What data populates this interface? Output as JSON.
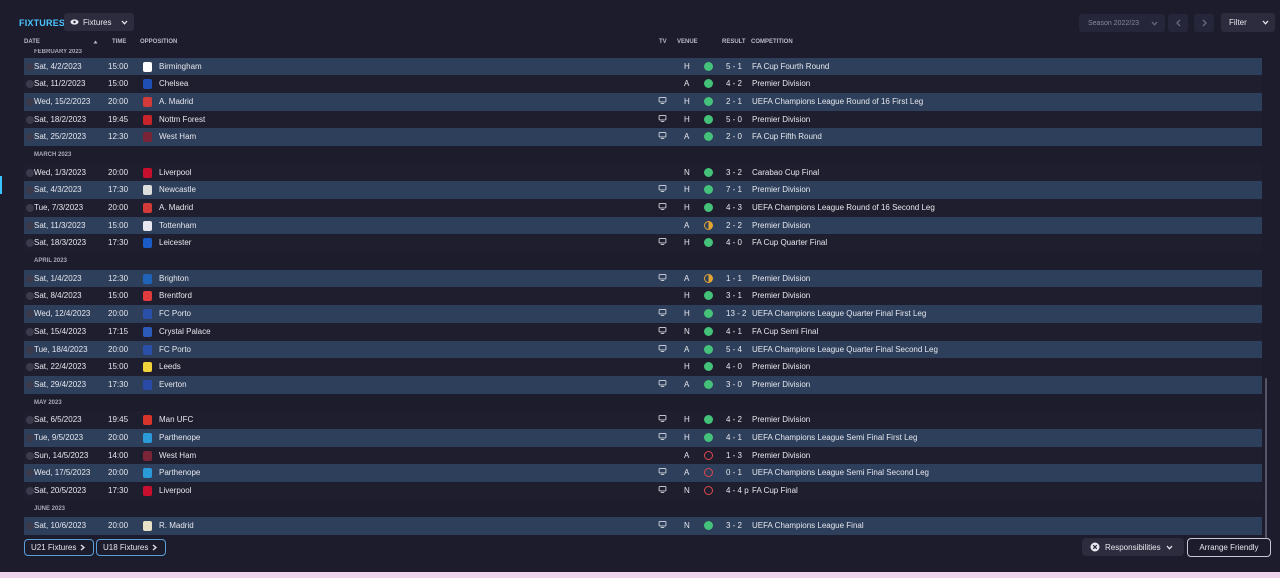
{
  "title": "FIXTURES",
  "view_selector": {
    "label": "Fixtures",
    "icon": "eye-icon"
  },
  "season": {
    "label": "Season 2022/23"
  },
  "filter_label": "Filter",
  "columns": {
    "date": "DATE",
    "time": "TIME",
    "opposition": "OPPOSITION",
    "tv": "TV",
    "venue": "VENUE",
    "result": "RESULT",
    "competition": "COMPETITION"
  },
  "sort": {
    "column": "date",
    "direction": "ascending"
  },
  "colors": {
    "win": "#45c27a",
    "draw": "#e4a535",
    "loss": "#e0474c",
    "accent": "#4cc5ff"
  },
  "sections": [
    {
      "month": "FEBRUARY 2023",
      "fixtures": [
        {
          "date": "Sat, 4/2/2023",
          "time": "15:00",
          "opp": "Birmingham",
          "crest": "#ffffff",
          "tv": false,
          "venue": "H",
          "outcome": "win",
          "result": "5 - 1",
          "comp": "FA Cup Fourth Round"
        },
        {
          "date": "Sat, 11/2/2023",
          "time": "15:00",
          "opp": "Chelsea",
          "crest": "#1f4fb4",
          "tv": false,
          "venue": "A",
          "outcome": "win",
          "result": "4 - 2",
          "comp": "Premier Division"
        },
        {
          "date": "Wed, 15/2/2023",
          "time": "20:00",
          "opp": "A. Madrid",
          "crest": "#d33a3a",
          "tv": true,
          "venue": "H",
          "outcome": "win",
          "result": "2 - 1",
          "comp": "UEFA Champions League Round of 16  First Leg"
        },
        {
          "date": "Sat, 18/2/2023",
          "time": "19:45",
          "opp": "Nottm Forest",
          "crest": "#c8242c",
          "tv": true,
          "venue": "H",
          "outcome": "win",
          "result": "5 - 0",
          "comp": "Premier Division"
        },
        {
          "date": "Sat, 25/2/2023",
          "time": "12:30",
          "opp": "West Ham",
          "crest": "#7a2438",
          "tv": true,
          "venue": "A",
          "outcome": "win",
          "result": "2 - 0",
          "comp": "FA Cup Fifth Round"
        }
      ]
    },
    {
      "month": "MARCH 2023",
      "fixtures": [
        {
          "date": "Wed, 1/3/2023",
          "time": "20:00",
          "opp": "Liverpool",
          "crest": "#c8102e",
          "tv": false,
          "venue": "N",
          "outcome": "win",
          "result": "3 - 2",
          "comp": "Carabao Cup Final"
        },
        {
          "date": "Sat, 4/3/2023",
          "time": "17:30",
          "opp": "Newcastle",
          "crest": "#dddddd",
          "tv": true,
          "venue": "H",
          "outcome": "win",
          "result": "7 - 1",
          "comp": "Premier Division"
        },
        {
          "date": "Tue, 7/3/2023",
          "time": "20:00",
          "opp": "A. Madrid",
          "crest": "#d33a3a",
          "tv": true,
          "venue": "H",
          "outcome": "win",
          "result": "4 - 3",
          "comp": "UEFA Champions League Round of 16  Second Leg"
        },
        {
          "date": "Sat, 11/3/2023",
          "time": "15:00",
          "opp": "Tottenham",
          "crest": "#e8e8f0",
          "tv": false,
          "venue": "A",
          "outcome": "draw",
          "result": "2 - 2",
          "comp": "Premier Division"
        },
        {
          "date": "Sat, 18/3/2023",
          "time": "17:30",
          "opp": "Leicester",
          "crest": "#1a5cc8",
          "tv": true,
          "venue": "H",
          "outcome": "win",
          "result": "4 - 0",
          "comp": "FA Cup Quarter Final"
        }
      ]
    },
    {
      "month": "APRIL 2023",
      "fixtures": [
        {
          "date": "Sat, 1/4/2023",
          "time": "12:30",
          "opp": "Brighton",
          "crest": "#1e63b8",
          "tv": true,
          "venue": "A",
          "outcome": "draw",
          "result": "1 - 1",
          "comp": "Premier Division"
        },
        {
          "date": "Sat, 8/4/2023",
          "time": "15:00",
          "opp": "Brentford",
          "crest": "#e03a3e",
          "tv": false,
          "venue": "H",
          "outcome": "win",
          "result": "3 - 1",
          "comp": "Premier Division"
        },
        {
          "date": "Wed, 12/4/2023",
          "time": "20:00",
          "opp": "FC Porto",
          "crest": "#2a4fa8",
          "tv": true,
          "venue": "H",
          "outcome": "win",
          "result": "13 - 2",
          "comp": "UEFA Champions League Quarter Final First Leg"
        },
        {
          "date": "Sat, 15/4/2023",
          "time": "17:15",
          "opp": "Crystal Palace",
          "crest": "#2c5ab8",
          "tv": true,
          "venue": "N",
          "outcome": "win",
          "result": "4 - 1",
          "comp": "FA Cup Semi Final"
        },
        {
          "date": "Tue, 18/4/2023",
          "time": "20:00",
          "opp": "FC Porto",
          "crest": "#2a4fa8",
          "tv": true,
          "venue": "A",
          "outcome": "win",
          "result": "5 - 4",
          "comp": "UEFA Champions League Quarter Final Second Leg"
        },
        {
          "date": "Sat, 22/4/2023",
          "time": "15:00",
          "opp": "Leeds",
          "crest": "#f0d23a",
          "tv": false,
          "venue": "H",
          "outcome": "win",
          "result": "4 - 0",
          "comp": "Premier Division"
        },
        {
          "date": "Sat, 29/4/2023",
          "time": "17:30",
          "opp": "Everton",
          "crest": "#2a4aa8",
          "tv": true,
          "venue": "A",
          "outcome": "win",
          "result": "3 - 0",
          "comp": "Premier Division"
        }
      ]
    },
    {
      "month": "MAY 2023",
      "fixtures": [
        {
          "date": "Sat, 6/5/2023",
          "time": "19:45",
          "opp": "Man UFC",
          "crest": "#d8342c",
          "tv": true,
          "venue": "H",
          "outcome": "win",
          "result": "4 - 2",
          "comp": "Premier Division"
        },
        {
          "date": "Tue, 9/5/2023",
          "time": "20:00",
          "opp": "Parthenope",
          "crest": "#2a9ad8",
          "tv": true,
          "venue": "H",
          "outcome": "win",
          "result": "4 - 1",
          "comp": "UEFA Champions League Semi Final First Leg"
        },
        {
          "date": "Sun, 14/5/2023",
          "time": "14:00",
          "opp": "West Ham",
          "crest": "#7a2438",
          "tv": false,
          "venue": "A",
          "outcome": "loss",
          "result": "1 - 3",
          "comp": "Premier Division"
        },
        {
          "date": "Wed, 17/5/2023",
          "time": "20:00",
          "opp": "Parthenope",
          "crest": "#2a9ad8",
          "tv": true,
          "venue": "A",
          "outcome": "loss",
          "result": "0 - 1",
          "comp": "UEFA Champions League Semi Final Second Leg"
        },
        {
          "date": "Sat, 20/5/2023",
          "time": "17:30",
          "opp": "Liverpool",
          "crest": "#c8102e",
          "tv": true,
          "venue": "N",
          "outcome": "loss",
          "result": "4 - 4 p",
          "comp": "FA Cup Final"
        }
      ]
    },
    {
      "month": "JUNE 2023",
      "fixtures": [
        {
          "date": "Sat, 10/6/2023",
          "time": "20:00",
          "opp": "R. Madrid",
          "crest": "#e8e2c8",
          "tv": true,
          "venue": "N",
          "outcome": "win",
          "result": "3 - 2",
          "comp": "UEFA Champions League Final"
        }
      ]
    }
  ],
  "footer": {
    "u21": "U21 Fixtures",
    "u18": "U18 Fixtures",
    "responsibilities": "Responsibilities",
    "arrange": "Arrange Friendly"
  }
}
